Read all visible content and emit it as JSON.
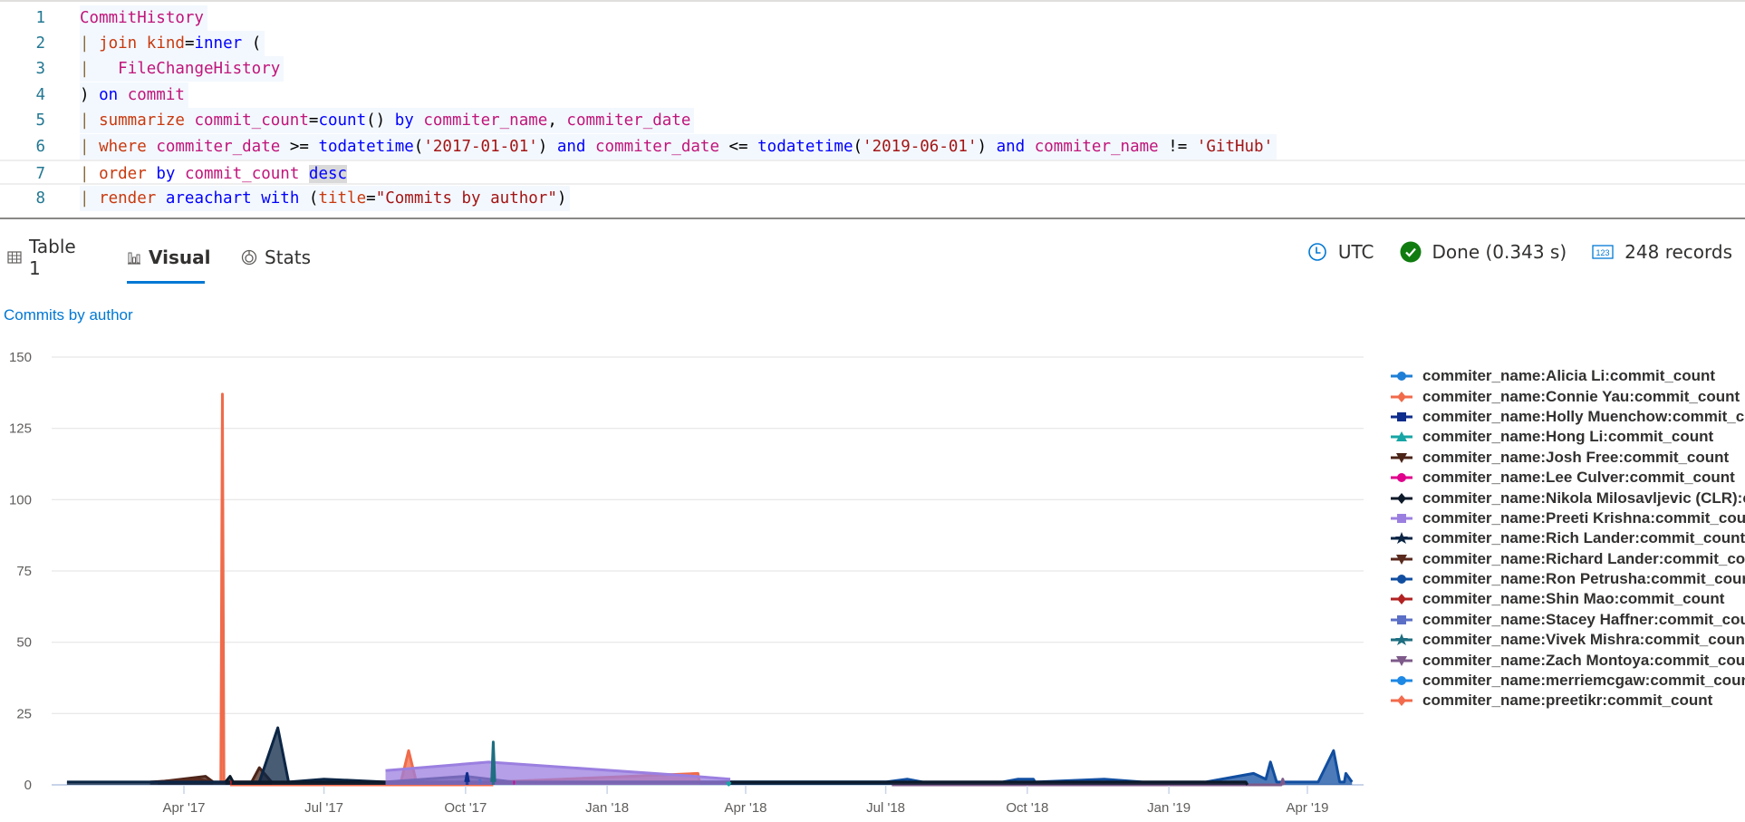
{
  "editor": {
    "lines": [
      {
        "num": "1",
        "tokens": [
          [
            "t-tbl",
            "CommitHistory"
          ]
        ]
      },
      {
        "num": "2",
        "tokens": [
          [
            "t-pipe",
            "| "
          ],
          [
            "t-kw",
            "join"
          ],
          [
            "t-op",
            " "
          ],
          [
            "t-kw",
            "kind"
          ],
          [
            "t-op",
            "="
          ],
          [
            "t-blue",
            "inner"
          ],
          [
            "t-op",
            " ("
          ]
        ]
      },
      {
        "num": "3",
        "tokens": [
          [
            "t-pipe",
            "|   "
          ],
          [
            "t-tbl",
            "FileChangeHistory"
          ]
        ]
      },
      {
        "num": "4",
        "tokens": [
          [
            "t-op",
            ") "
          ],
          [
            "t-blue",
            "on"
          ],
          [
            "t-op",
            " "
          ],
          [
            "t-col",
            "commit"
          ]
        ]
      },
      {
        "num": "5",
        "tokens": [
          [
            "t-pipe",
            "| "
          ],
          [
            "t-kw",
            "summarize"
          ],
          [
            "t-op",
            " "
          ],
          [
            "t-col",
            "commit_count"
          ],
          [
            "t-op",
            "="
          ],
          [
            "t-blue",
            "count"
          ],
          [
            "t-op",
            "() "
          ],
          [
            "t-blue",
            "by"
          ],
          [
            "t-op",
            " "
          ],
          [
            "t-col",
            "commiter_name"
          ],
          [
            "t-op",
            ", "
          ],
          [
            "t-col",
            "commiter_date"
          ]
        ]
      },
      {
        "num": "6",
        "tokens": [
          [
            "t-pipe",
            "| "
          ],
          [
            "t-kw",
            "where"
          ],
          [
            "t-op",
            " "
          ],
          [
            "t-col",
            "commiter_date"
          ],
          [
            "t-op",
            " >= "
          ],
          [
            "t-blue",
            "todatetime"
          ],
          [
            "t-op",
            "("
          ],
          [
            "t-str",
            "'2017-01-01'"
          ],
          [
            "t-op",
            ") "
          ],
          [
            "t-blue",
            "and"
          ],
          [
            "t-op",
            " "
          ],
          [
            "t-col",
            "commiter_date"
          ],
          [
            "t-op",
            " <= "
          ],
          [
            "t-blue",
            "todatetime"
          ],
          [
            "t-op",
            "("
          ],
          [
            "t-str",
            "'2019-06-01'"
          ],
          [
            "t-op",
            ") "
          ],
          [
            "t-blue",
            "and"
          ],
          [
            "t-op",
            " "
          ],
          [
            "t-col",
            "commiter_name"
          ],
          [
            "t-op",
            " != "
          ],
          [
            "t-str",
            "'GitHub'"
          ]
        ]
      },
      {
        "num": "7",
        "tokens": [
          [
            "t-pipe",
            "| "
          ],
          [
            "t-kw",
            "order"
          ],
          [
            "t-op",
            " "
          ],
          [
            "t-blue",
            "by"
          ],
          [
            "t-op",
            " "
          ],
          [
            "t-col",
            "commit_count"
          ],
          [
            "t-op",
            " "
          ],
          [
            "t-blue t-sel",
            "desc"
          ]
        ],
        "current": true
      },
      {
        "num": "8",
        "tokens": [
          [
            "t-pipe",
            "| "
          ],
          [
            "t-kw",
            "render"
          ],
          [
            "t-op",
            " "
          ],
          [
            "t-blue",
            "areachart"
          ],
          [
            "t-op",
            " "
          ],
          [
            "t-blue",
            "with"
          ],
          [
            "t-op",
            " ("
          ],
          [
            "t-kw",
            "title"
          ],
          [
            "t-op",
            "="
          ],
          [
            "t-str",
            "\"Commits by author\""
          ],
          [
            "t-op",
            ")"
          ]
        ]
      }
    ]
  },
  "tabs": [
    {
      "label": "Table 1",
      "icon": "table-icon",
      "active": false
    },
    {
      "label": "Visual",
      "icon": "chart-icon",
      "active": true
    },
    {
      "label": "Stats",
      "icon": "stats-icon",
      "active": false
    }
  ],
  "status": {
    "timezone": "UTC",
    "done": "Done (0.343 s)",
    "records": "248 records",
    "done_color": "#107c10",
    "accent": "#0078d4"
  },
  "chart_data": {
    "type": "area",
    "title": "Commits by author",
    "xlabel": "",
    "ylabel": "",
    "ylim": [
      0,
      150
    ],
    "yticks": [
      0,
      25,
      50,
      75,
      100,
      125,
      150
    ],
    "xticks": [
      {
        "label": "Apr '17",
        "date": "2017-04-01"
      },
      {
        "label": "Jul '17",
        "date": "2017-07-01"
      },
      {
        "label": "Oct '17",
        "date": "2017-10-01"
      },
      {
        "label": "Jan '18",
        "date": "2018-01-01"
      },
      {
        "label": "Apr '18",
        "date": "2018-04-01"
      },
      {
        "label": "Jul '18",
        "date": "2018-07-01"
      },
      {
        "label": "Oct '18",
        "date": "2018-10-01"
      },
      {
        "label": "Jan '19",
        "date": "2019-01-01"
      },
      {
        "label": "Apr '19",
        "date": "2019-04-01"
      }
    ],
    "xlim": [
      "2017-01-09",
      "2019-04-30"
    ],
    "grid": true,
    "legend_position": "right",
    "series": [
      {
        "name": "commiter_name:Alicia Li:commit_count",
        "color": "#1f7fd6",
        "marker": "circle",
        "points": [
          [
            "2017-10-20",
            1
          ],
          [
            "2018-01-15",
            1
          ],
          [
            "2018-04-15",
            1
          ],
          [
            "2018-06-25",
            1
          ],
          [
            "2018-07-05",
            1
          ]
        ]
      },
      {
        "name": "commiter_name:Connie Yau:commit_count",
        "color": "#f06b4a",
        "marker": "diamond",
        "points": [
          [
            "2017-04-25",
            1
          ],
          [
            "2017-04-26",
            137
          ],
          [
            "2017-04-27",
            1
          ],
          [
            "2017-05-01",
            1
          ],
          [
            "2017-08-20",
            1
          ],
          [
            "2017-08-25",
            12
          ],
          [
            "2017-08-30",
            1
          ],
          [
            "2017-10-20",
            1
          ],
          [
            "2018-03-01",
            4
          ],
          [
            "2018-03-02",
            1
          ]
        ]
      },
      {
        "name": "commiter_name:Holly Muenchow:commit_count",
        "color": "#0f2d8c",
        "marker": "square",
        "points": [
          [
            "2017-10-01",
            1
          ],
          [
            "2017-10-02",
            4
          ],
          [
            "2017-10-03",
            1
          ]
        ]
      },
      {
        "name": "commiter_name:Hong Li:commit_count",
        "color": "#17a5a5",
        "marker": "triangle-up",
        "points": [
          [
            "2018-03-20",
            1
          ],
          [
            "2018-03-21",
            0
          ],
          [
            "2018-03-22",
            1
          ]
        ]
      },
      {
        "name": "commiter_name:Josh Free:commit_count",
        "color": "#4b2418",
        "marker": "triangle-down",
        "points": [
          [
            "2017-03-15",
            1
          ],
          [
            "2017-04-15",
            3
          ],
          [
            "2017-04-20",
            1
          ],
          [
            "2017-05-15",
            1
          ],
          [
            "2017-05-20",
            6
          ],
          [
            "2017-05-28",
            1
          ]
        ]
      },
      {
        "name": "commiter_name:Lee Culver:commit_count",
        "color": "#e0008c",
        "marker": "circle",
        "points": [
          [
            "2017-11-01",
            1
          ],
          [
            "2017-11-02",
            1
          ]
        ]
      },
      {
        "name": "commiter_name:Nikola Milosavljevic (CLR):commit_count",
        "color": "#0d1a2a",
        "marker": "diamond",
        "points": [
          [
            "2017-04-28",
            1
          ],
          [
            "2017-05-01",
            3
          ],
          [
            "2017-05-03",
            1
          ],
          [
            "2019-02-20",
            1
          ],
          [
            "2019-02-21",
            0
          ]
        ]
      },
      {
        "name": "commiter_name:Preeti Krishna:commit_count",
        "color": "#9b7fe0",
        "marker": "square",
        "points": [
          [
            "2017-08-10",
            5
          ],
          [
            "2017-10-16",
            8
          ],
          [
            "2018-02-27",
            3
          ],
          [
            "2018-03-22",
            2
          ]
        ]
      },
      {
        "name": "commiter_name:Rich Lander:commit_count",
        "color": "#0b2545",
        "marker": "star",
        "points": [
          [
            "2017-01-15",
            1
          ],
          [
            "2017-05-20",
            1
          ],
          [
            "2017-06-01",
            20
          ],
          [
            "2017-06-08",
            1
          ],
          [
            "2017-07-01",
            2
          ],
          [
            "2017-08-10",
            1
          ],
          [
            "2017-10-01",
            3
          ],
          [
            "2017-11-01",
            1
          ]
        ]
      },
      {
        "name": "commiter_name:Richard Lander:commit_count",
        "color": "#5a2a1e",
        "marker": "triangle-down",
        "points": [
          [
            "2017-03-10",
            1
          ],
          [
            "2017-04-10",
            2
          ],
          [
            "2017-04-20",
            1
          ]
        ]
      },
      {
        "name": "commiter_name:Ron Petrusha:commit_count",
        "color": "#114ea0",
        "marker": "circle",
        "points": [
          [
            "2017-12-15",
            1
          ],
          [
            "2018-07-01",
            1
          ],
          [
            "2018-07-15",
            2
          ],
          [
            "2018-07-25",
            1
          ],
          [
            "2018-09-15",
            1
          ],
          [
            "2018-09-25",
            2
          ],
          [
            "2018-10-05",
            2
          ],
          [
            "2018-10-06",
            1
          ],
          [
            "2018-11-20",
            2
          ],
          [
            "2018-12-15",
            1
          ],
          [
            "2019-01-25",
            1
          ],
          [
            "2019-02-25",
            4
          ],
          [
            "2019-03-05",
            2
          ],
          [
            "2019-03-08",
            8
          ],
          [
            "2019-03-12",
            1
          ],
          [
            "2019-03-15",
            1
          ],
          [
            "2019-04-08",
            1
          ],
          [
            "2019-04-18",
            12
          ],
          [
            "2019-04-22",
            1
          ],
          [
            "2019-04-25",
            1
          ],
          [
            "2019-04-26",
            4
          ],
          [
            "2019-04-30",
            1
          ]
        ]
      },
      {
        "name": "commiter_name:Shin Mao:commit_count",
        "color": "#b22222",
        "marker": "diamond",
        "points": [
          [
            "2017-05-01",
            1
          ],
          [
            "2017-05-02",
            1
          ]
        ]
      },
      {
        "name": "commiter_name:Stacey Haffner:commit_count",
        "color": "#5b6fc6",
        "marker": "square",
        "points": [
          [
            "2017-10-10",
            2
          ],
          [
            "2017-10-11",
            1
          ]
        ]
      },
      {
        "name": "commiter_name:Vivek Mishra:commit_count",
        "color": "#1d6e80",
        "marker": "star",
        "points": [
          [
            "2017-10-18",
            1
          ],
          [
            "2017-10-19",
            15
          ],
          [
            "2017-10-20",
            1
          ]
        ]
      },
      {
        "name": "commiter_name:Zach Montoya:commit_count",
        "color": "#7d5a8a",
        "marker": "triangle-down",
        "points": [
          [
            "2018-07-05",
            0
          ],
          [
            "2019-03-15",
            0
          ],
          [
            "2019-03-16",
            2
          ],
          [
            "2019-03-17",
            0
          ]
        ]
      },
      {
        "name": "commiter_name:merriemcgaw:commit_count",
        "color": "#1e88e5",
        "marker": "circle",
        "points": [
          [
            "2017-10-20",
            1
          ],
          [
            "2018-03-15",
            1
          ],
          [
            "2018-06-28",
            1
          ],
          [
            "2018-07-01",
            1
          ]
        ]
      },
      {
        "name": "commiter_name:preetikr:commit_count",
        "color": "#f26b4c",
        "marker": "diamond",
        "points": [
          [
            "2017-05-01",
            0
          ],
          [
            "2017-10-19",
            0
          ]
        ]
      }
    ]
  }
}
